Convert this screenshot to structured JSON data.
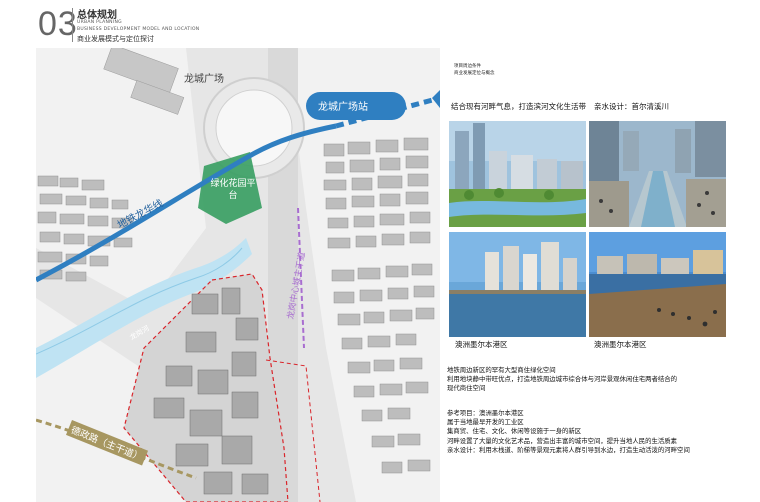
{
  "header": {
    "number": "03",
    "title": "总体规划",
    "en_line1": "URBAN PLANNING",
    "en_line2": "BUSINESS DEVELOPMENT MODEL AND LOCATION",
    "subtitle": "商业发展模式与定位探讨"
  },
  "map": {
    "label_plaza": "龙城广场",
    "label_station": "龙城广场站",
    "label_green": "绿化花园平台",
    "label_metro": "地铁龙华线",
    "label_road_main": "龙岗中心城主干道",
    "label_road_bottom": "德政路（主干道）",
    "label_river": "龙岗河"
  },
  "right": {
    "tag1": "项目周边条件",
    "tag2": "商业发展定位与概念",
    "intro": "结合现有河畔气息，打造滨河文化生活带",
    "ref_seoul": "亲水设计：首尔清溪川",
    "caption_left": "澳洲墨尔本港区",
    "caption_right": "澳洲墨尔本港区",
    "block1": [
      "地铁周边新区的罕有大型商住绿化空间",
      "利用地块静中带旺优点，打造地铁周边城市综合体与河岸景观休闲住宅两者结合的",
      "现代商住空间"
    ],
    "block2": [
      "参考项目：澳洲墨尔本港区",
      "属于当地最早开发的工业区",
      "集商贸、住宅、文化、休闲等设施于一身的新区",
      "河畔设置了大量的文化艺术品，营造出丰富的城市空间，提升当地人民的生活质素",
      "亲水设计：利用木栈道、阶梯等景观元素将人群引导到水边，打造生动活泼的河畔空间"
    ]
  }
}
